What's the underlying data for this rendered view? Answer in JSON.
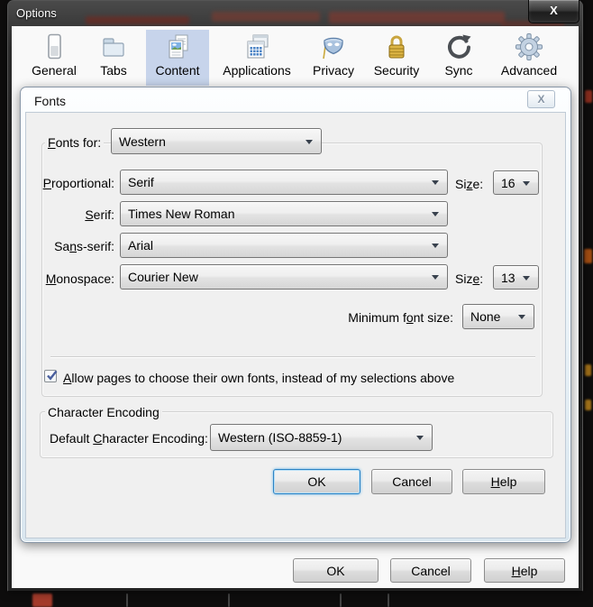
{
  "options_window": {
    "title": "Options",
    "tabs": [
      {
        "label": "General",
        "icon": "general-icon",
        "selected": false
      },
      {
        "label": "Tabs",
        "icon": "tabs-icon",
        "selected": false
      },
      {
        "label": "Content",
        "icon": "content-icon",
        "selected": true
      },
      {
        "label": "Applications",
        "icon": "applications-icon",
        "selected": false
      },
      {
        "label": "Privacy",
        "icon": "privacy-icon",
        "selected": false
      },
      {
        "label": "Security",
        "icon": "security-icon",
        "selected": false
      },
      {
        "label": "Sync",
        "icon": "sync-icon",
        "selected": false
      },
      {
        "label": "Advanced",
        "icon": "advanced-icon",
        "selected": false
      }
    ],
    "buttons": {
      "ok": "OK",
      "cancel": "Cancel",
      "help": {
        "pre": "",
        "key": "H",
        "post": "elp"
      }
    }
  },
  "fonts_dialog": {
    "title": "Fonts",
    "fonts_for": {
      "label": {
        "pre": "",
        "key": "F",
        "post": "onts for:"
      },
      "value": "Western"
    },
    "font_rows": [
      {
        "label": {
          "pre": "",
          "key": "P",
          "post": "roportional:"
        },
        "value": "Serif",
        "size_label": {
          "pre": "Si",
          "key": "z",
          "post": "e:"
        },
        "size_value": "16"
      },
      {
        "label": {
          "pre": "",
          "key": "S",
          "post": "erif:"
        },
        "value": "Times New Roman"
      },
      {
        "label": {
          "pre": "Sa",
          "key": "n",
          "post": "s-serif:"
        },
        "value": "Arial"
      },
      {
        "label": {
          "pre": "",
          "key": "M",
          "post": "onospace:"
        },
        "value": "Courier New",
        "size_label": {
          "pre": "Siz",
          "key": "e",
          "post": ":"
        },
        "size_value": "13"
      }
    ],
    "minimum_font_size": {
      "label": {
        "pre": "Minimum f",
        "key": "o",
        "post": "nt size:"
      },
      "value": "None"
    },
    "allow_pages_checkbox": {
      "checked": true,
      "label": {
        "pre": "",
        "key": "A",
        "post": "llow pages to choose their own fonts, instead of my selections above"
      }
    },
    "character_encoding": {
      "group_label": "Character Encoding",
      "field_label": {
        "pre": "Default ",
        "key": "C",
        "post": "haracter Encoding:"
      },
      "value": "Western (ISO-8859-1)"
    },
    "buttons": {
      "ok": "OK",
      "cancel": "Cancel",
      "help": {
        "pre": "",
        "key": "H",
        "post": "elp"
      }
    }
  },
  "icons": {
    "window_close_glyph": "X",
    "dialog_close_glyph": "X"
  },
  "colors": {
    "selected_tab_bg": "#c7d4eb",
    "titlebar_bg": "#2a2a2a",
    "dialog_client_bg": "#f0f0f0",
    "default_button_border": "#2e83c3",
    "checkbox_check": "#4a5f9e",
    "security_lock_gold": "#d4ab3a"
  }
}
